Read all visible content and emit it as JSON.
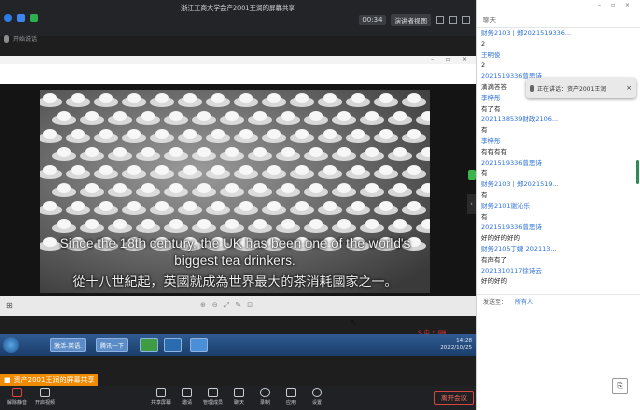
{
  "window": {
    "title": "浙江工商大学会产2001王润的屏幕共享",
    "timer": "00:34",
    "view_mode": "演讲者视图"
  },
  "speaker_bar": {
    "label": "开始说话"
  },
  "share": {
    "subtitle_line1": "Since the 18th century, the UK has been one of the world's",
    "subtitle_line2": "biggest tea drinkers.",
    "subtitle_line3": "從十八世紀起，英國就成為世界最大的茶消耗國家之一。"
  },
  "taskbar": {
    "btn1": "激活-英语.",
    "btn2": "腾讯一下",
    "clock_time": "14:28",
    "clock_date": "2022/10/25"
  },
  "sharer_banner": {
    "label": "资产2001王润的屏幕共享"
  },
  "bottom_toolbar": {
    "items": [
      {
        "label": "解除静音"
      },
      {
        "label": "开启视频"
      },
      {
        "label": "共享屏幕"
      },
      {
        "label": "邀请"
      },
      {
        "label": "管理成员"
      },
      {
        "label": "聊天"
      },
      {
        "label": "录制"
      },
      {
        "label": "应用"
      },
      {
        "label": "设置"
      }
    ],
    "end_label": "离开会议"
  },
  "chat": {
    "header_label": "聊天",
    "messages": [
      {
        "kind": "sender",
        "text": "财务2103丨郑2021519336..."
      },
      {
        "kind": "text",
        "text": "2"
      },
      {
        "kind": "sender",
        "text": "王明俊"
      },
      {
        "kind": "text",
        "text": "2"
      },
      {
        "kind": "sender",
        "text": "2021519336曾思诗"
      },
      {
        "kind": "text",
        "text": "滴滴答答"
      },
      {
        "kind": "sender",
        "text": "李梓彤"
      },
      {
        "kind": "text",
        "text": "有了有"
      },
      {
        "kind": "sender",
        "text": "2021138539财政2106..."
      },
      {
        "kind": "text",
        "text": "有"
      },
      {
        "kind": "sender",
        "text": "李梓彤"
      },
      {
        "kind": "text",
        "text": "有有有有"
      },
      {
        "kind": "sender",
        "text": "2021519336曾思诗"
      },
      {
        "kind": "text",
        "text": "有"
      },
      {
        "kind": "sender",
        "text": "财务2103丨郑2021519..."
      },
      {
        "kind": "text",
        "text": "有"
      },
      {
        "kind": "sender",
        "text": "财务2101谢沁乐"
      },
      {
        "kind": "text",
        "text": "有"
      },
      {
        "kind": "sender",
        "text": "2021519336曾思诗"
      },
      {
        "kind": "text",
        "text": "好的好的好的"
      },
      {
        "kind": "sender",
        "text": "财务2105丁婕 202113..."
      },
      {
        "kind": "text",
        "text": "有声有了"
      },
      {
        "kind": "sender",
        "text": "2021310117徐诗云"
      },
      {
        "kind": "text",
        "text": "好的好的"
      }
    ],
    "notification": "正在讲话：资产2001王润",
    "send_to_label": "发送至：",
    "send_to_value": "所有人"
  }
}
